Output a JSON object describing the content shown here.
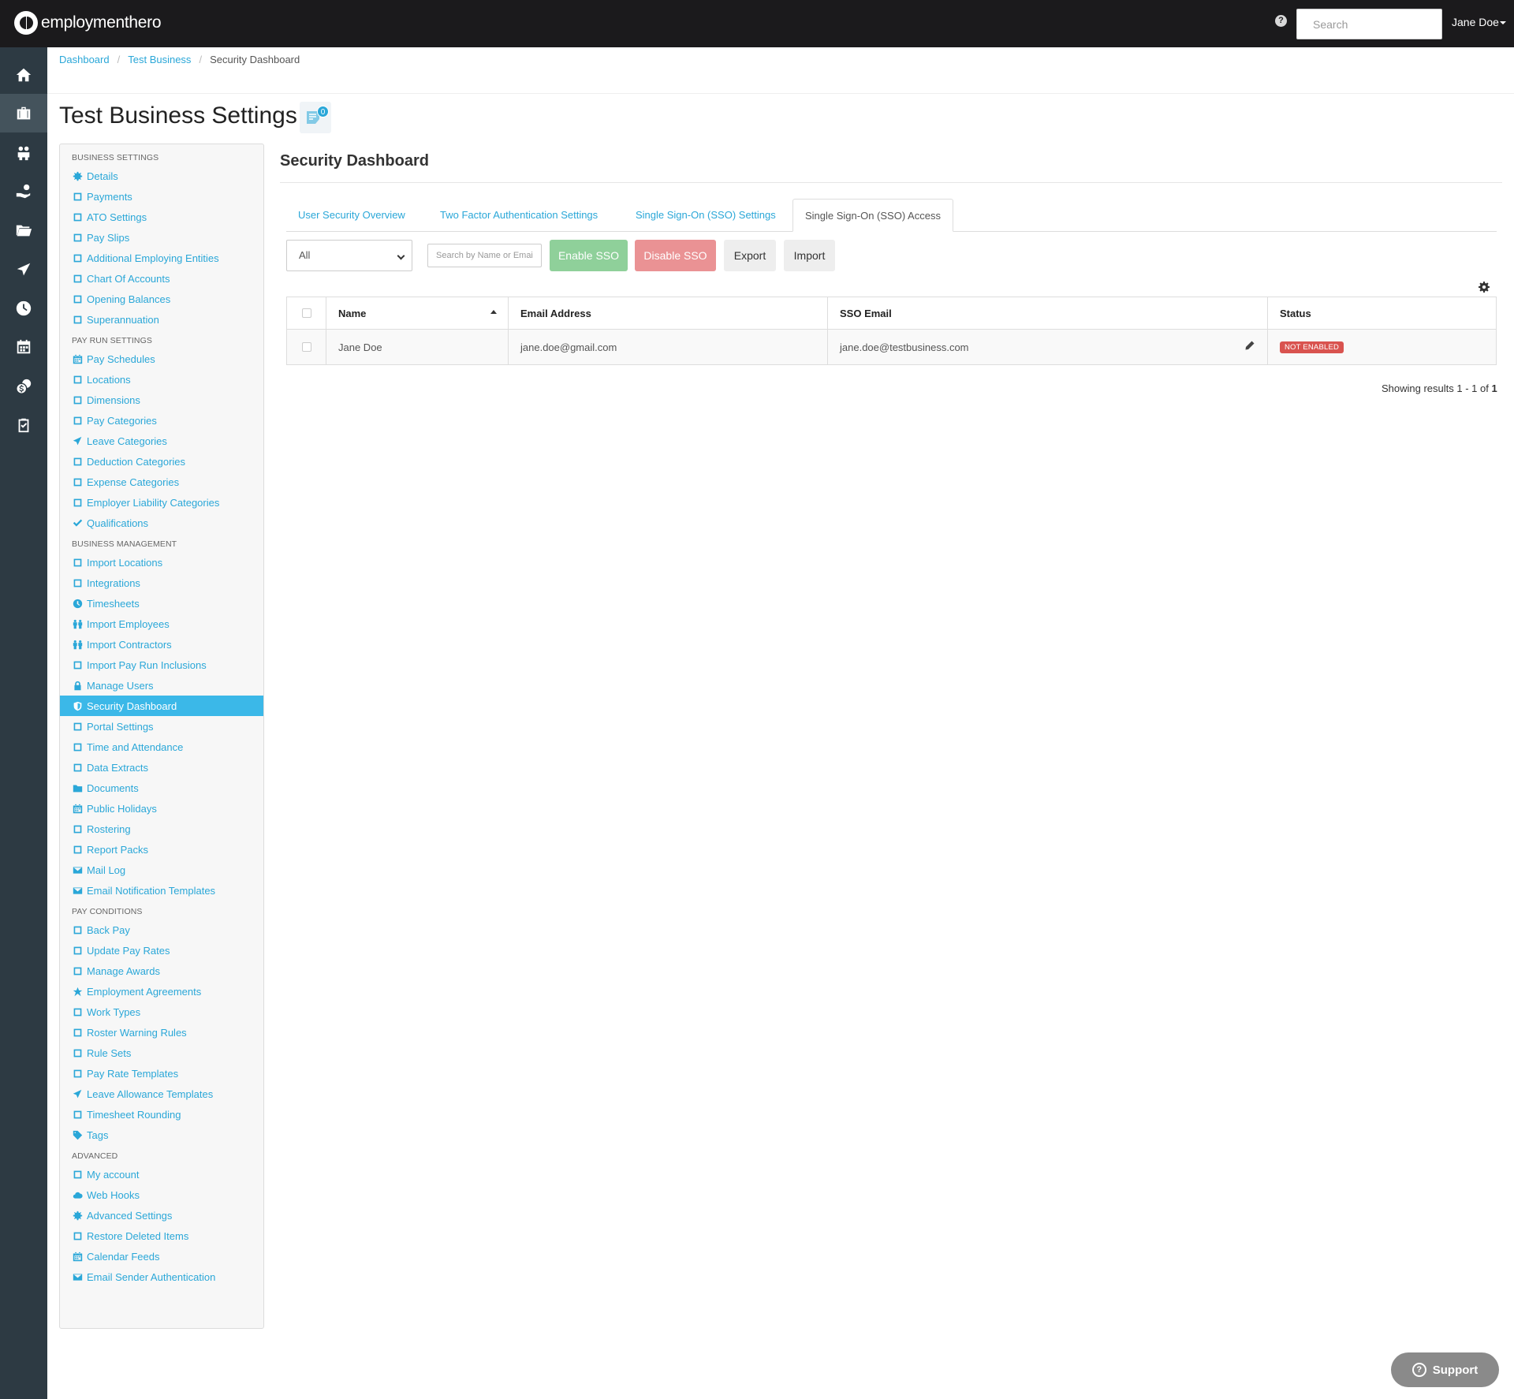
{
  "app": {
    "logo_text": "employmenthero"
  },
  "topbar": {
    "search_placeholder": "Search",
    "user_name": "Jane Doe",
    "help_symbol": "?"
  },
  "breadcrumb": {
    "items": [
      "Dashboard",
      "Test Business"
    ],
    "current": "Security Dashboard"
  },
  "page": {
    "title": "Test Business Settings",
    "notification_count": "0"
  },
  "rail": {
    "icons": [
      "home-icon",
      "briefcase-icon",
      "people-icon",
      "hand-money-icon",
      "folder-icon",
      "plane-icon",
      "clock-icon",
      "calendar-icon",
      "dollar-coin-icon",
      "clipboard-check-icon"
    ],
    "active_index": 1
  },
  "sidebar": {
    "sections": [
      {
        "title": "BUSINESS SETTINGS",
        "items": [
          {
            "label": "Details",
            "icon": "gear-icon"
          },
          {
            "label": "Payments",
            "icon": "save-icon"
          },
          {
            "label": "ATO Settings",
            "icon": "scale-icon"
          },
          {
            "label": "Pay Slips",
            "icon": "file-icon"
          },
          {
            "label": "Additional Employing Entities",
            "icon": "bank-icon"
          },
          {
            "label": "Chart Of Accounts",
            "icon": "list-icon"
          },
          {
            "label": "Opening Balances",
            "icon": "balance-icon"
          },
          {
            "label": "Superannuation",
            "icon": "life-ring-icon"
          }
        ]
      },
      {
        "title": "PAY RUN SETTINGS",
        "items": [
          {
            "label": "Pay Schedules",
            "icon": "calendar-icon"
          },
          {
            "label": "Locations",
            "icon": "globe-icon"
          },
          {
            "label": "Dimensions",
            "icon": "bar-chart-icon"
          },
          {
            "label": "Pay Categories",
            "icon": "money-icon"
          },
          {
            "label": "Leave Categories",
            "icon": "plane-icon"
          },
          {
            "label": "Deduction Categories",
            "icon": "minus-circle-icon"
          },
          {
            "label": "Expense Categories",
            "icon": "dollar-icon"
          },
          {
            "label": "Employer Liability Categories",
            "icon": "factory-icon"
          },
          {
            "label": "Qualifications",
            "icon": "check-icon"
          }
        ]
      },
      {
        "title": "BUSINESS MANAGEMENT",
        "items": [
          {
            "label": "Import Locations",
            "icon": "map-pin-icon"
          },
          {
            "label": "Integrations",
            "icon": "plug-icon"
          },
          {
            "label": "Timesheets",
            "icon": "clock-icon"
          },
          {
            "label": "Import Employees",
            "icon": "people-icon"
          },
          {
            "label": "Import Contractors",
            "icon": "people-icon"
          },
          {
            "label": "Import Pay Run Inclusions",
            "icon": "refresh-icon"
          },
          {
            "label": "Manage Users",
            "icon": "lock-icon"
          },
          {
            "label": "Security Dashboard",
            "icon": "shield-icon"
          },
          {
            "label": "Portal Settings",
            "icon": "magic-wand-icon"
          },
          {
            "label": "Time and Attendance",
            "icon": "stopwatch-icon"
          },
          {
            "label": "Data Extracts",
            "icon": "cloud-download-icon"
          },
          {
            "label": "Documents",
            "icon": "folder-icon"
          },
          {
            "label": "Public Holidays",
            "icon": "calendar-icon"
          },
          {
            "label": "Rostering",
            "icon": "calendar-grid-icon"
          },
          {
            "label": "Report Packs",
            "icon": "folder-open-icon"
          },
          {
            "label": "Mail Log",
            "icon": "envelope-icon"
          },
          {
            "label": "Email Notification Templates",
            "icon": "envelope-icon"
          }
        ]
      },
      {
        "title": "PAY CONDITIONS",
        "items": [
          {
            "label": "Back Pay",
            "icon": "history-icon"
          },
          {
            "label": "Update Pay Rates",
            "icon": "hand-money-icon"
          },
          {
            "label": "Manage Awards",
            "icon": "exchange-icon"
          },
          {
            "label": "Employment Agreements",
            "icon": "star-icon"
          },
          {
            "label": "Work Types",
            "icon": "camera-icon"
          },
          {
            "label": "Roster Warning Rules",
            "icon": "calendar-warning-icon"
          },
          {
            "label": "Rule Sets",
            "icon": "gavel-icon"
          },
          {
            "label": "Pay Rate Templates",
            "icon": "money-icon"
          },
          {
            "label": "Leave Allowance Templates",
            "icon": "plane-icon"
          },
          {
            "label": "Timesheet Rounding",
            "icon": "clock-o-icon"
          },
          {
            "label": "Tags",
            "icon": "tag-icon"
          }
        ]
      },
      {
        "title": "ADVANCED",
        "items": [
          {
            "label": "My account",
            "icon": "user-circle-icon"
          },
          {
            "label": "Web Hooks",
            "icon": "cloud-icon"
          },
          {
            "label": "Advanced Settings",
            "icon": "gear-icon"
          },
          {
            "label": "Restore Deleted Items",
            "icon": "recycle-icon"
          },
          {
            "label": "Calendar Feeds",
            "icon": "calendar-icon"
          },
          {
            "label": "Email Sender Authentication",
            "icon": "envelope-icon"
          }
        ]
      }
    ],
    "active_label": "Security Dashboard"
  },
  "main": {
    "title": "Security Dashboard",
    "tabs": [
      {
        "label": "User Security Overview",
        "active": false
      },
      {
        "label": "Two Factor Authentication Settings",
        "active": false
      },
      {
        "label": "Single Sign-On (SSO) Settings",
        "active": false
      },
      {
        "label": "Single Sign-On (SSO) Access",
        "active": true
      }
    ],
    "filter": {
      "selected": "All"
    },
    "name_search_placeholder": "Search by Name or Email",
    "buttons": {
      "enable": "Enable SSO",
      "disable": "Disable SSO",
      "export": "Export",
      "import": "Import"
    },
    "table": {
      "columns": [
        "Name",
        "Email Address",
        "SSO Email",
        "Status"
      ],
      "rows": [
        {
          "name": "Jane Doe",
          "email": "jane.doe@gmail.com",
          "sso_email": "jane.doe@testbusiness.com",
          "status": "NOT ENABLED"
        }
      ]
    },
    "results": {
      "prefix": "Showing results 1 - 1 of ",
      "total": "1"
    }
  },
  "support": {
    "label": "Support",
    "symbol": "?"
  }
}
